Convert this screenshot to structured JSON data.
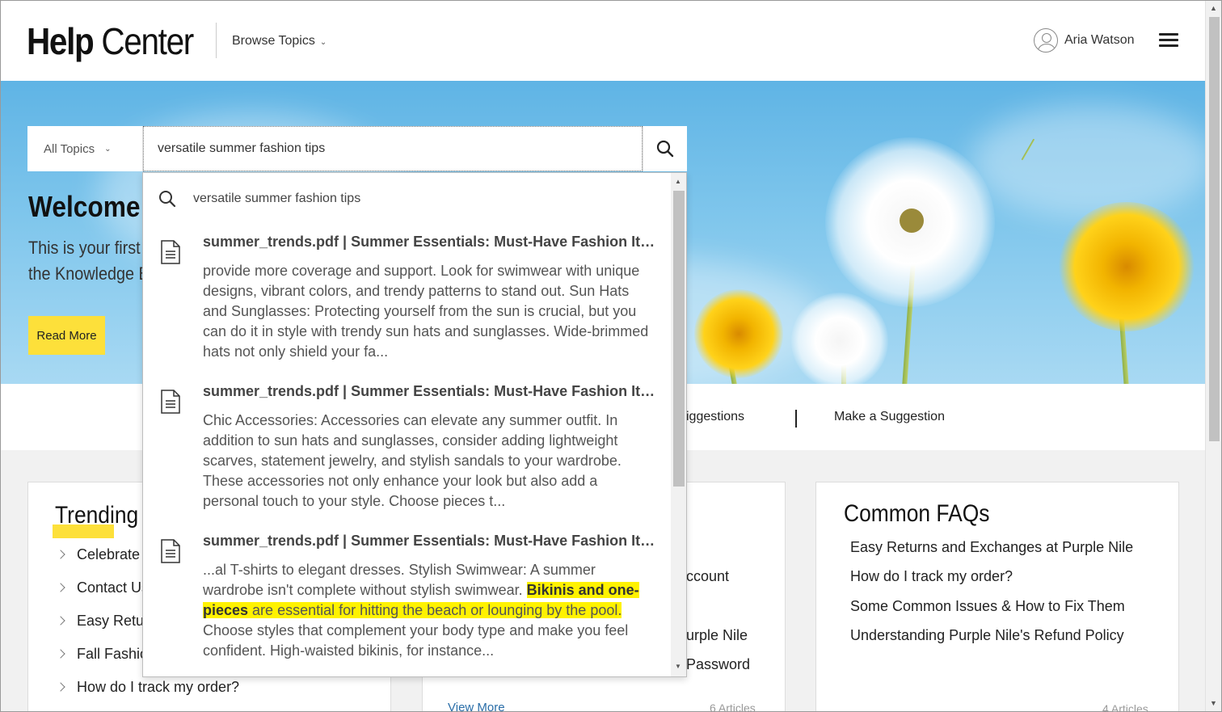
{
  "header": {
    "logo_bold": "Help",
    "logo_light": "Center",
    "browse_label": "Browse Topics",
    "user_name": "Aria Watson"
  },
  "hero": {
    "welcome": "Welcome",
    "subtitle_line1": "This is your first",
    "subtitle_line2": "the Knowledge B",
    "read_more": "Read More"
  },
  "search": {
    "topic_selected": "All Topics",
    "value": "versatile summer fashion tips"
  },
  "dropdown": {
    "query": "versatile summer fashion tips",
    "results": [
      {
        "title": "summer_trends.pdf | Summer Essentials: Must-Have Fashion Items for the Season",
        "snippet": "provide more coverage and support. Look for swimwear with unique designs, vibrant colors, and trendy patterns to stand out. Sun Hats and Sunglasses: Protecting yourself from the sun is crucial, but you can do it in style with trendy sun hats and sunglasses. Wide-brimmed hats not only shield your fa..."
      },
      {
        "title": "summer_trends.pdf | Summer Essentials: Must-Have Fashion Items for the Season",
        "snippet": "Chic Accessories: Accessories can elevate any summer outfit. In addition to sun hats and sunglasses, consider adding lightweight scarves, statement jewelry, and stylish sandals to your wardrobe. These accessories not only enhance your look but also add a personal touch to your style. Choose pieces t..."
      },
      {
        "title": "summer_trends.pdf | Summer Essentials: Must-Have Fashion Items for the Season",
        "snippet_pre": "...al T-shirts to elegant dresses. Stylish Swimwear: A summer wardrobe isn't complete without stylish swimwear. ",
        "snippet_bold": "Bikinis and one-pieces",
        "snippet_hl": " are essential for hitting the beach or lounging by the pool.",
        "snippet_post": " Choose styles that complement your body type and make you feel confident. High-waisted bikinis, for instance..."
      }
    ]
  },
  "nav_row": {
    "suggestions_partial": "iggestions",
    "make_suggestion": "Make a Suggestion"
  },
  "cards": {
    "trending": {
      "title": "Trending",
      "items": [
        "Celebrate",
        "Contact Us",
        "Easy Retur",
        "Fall Fashio",
        "How do I track my order?"
      ]
    },
    "middle": {
      "items": [
        "ccount",
        "urple Nile",
        "Password"
      ],
      "view_more": "View More",
      "count": "6 Articles"
    },
    "faqs": {
      "title": "Common FAQs",
      "items": [
        "Easy Returns and Exchanges at Purple Nile",
        "How do I track my order?",
        "Some Common Issues & How to Fix Them",
        "Understanding Purple Nile's Refund Policy"
      ],
      "count": "4 Articles"
    }
  },
  "icons": {
    "search": "search-icon",
    "document": "document-icon",
    "menu": "hamburger-menu-icon",
    "user": "user-avatar-icon"
  },
  "colors": {
    "accent_yellow": "#fde03a",
    "highlight": "#fff200",
    "link": "#2a6ea8"
  }
}
